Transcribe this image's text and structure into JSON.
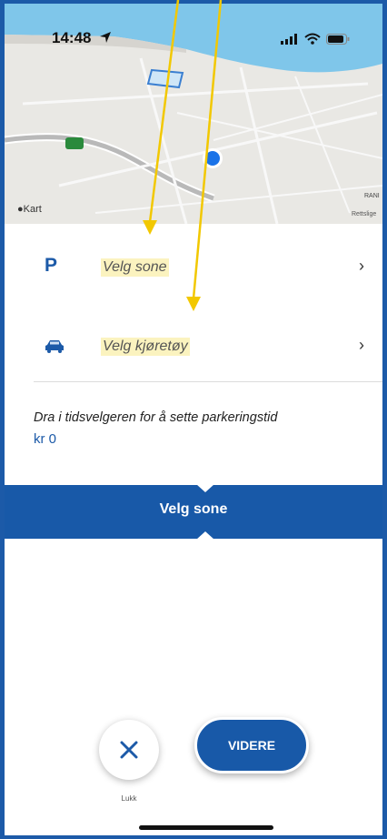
{
  "status_bar": {
    "time": "14:48"
  },
  "map": {
    "attribution": "Kart",
    "legal": "Rettslige",
    "place_label": "RANI"
  },
  "rows": [
    {
      "icon": "parking-p-icon",
      "glyph": "P",
      "label": "Velg sone"
    },
    {
      "icon": "car-icon",
      "label": "Velg kjøretøy"
    }
  ],
  "hint": "Dra i tidsvelgeren for å sette parkeringstid",
  "price": "kr 0",
  "band": {
    "title": "Velg sone"
  },
  "buttons": {
    "close_label": "Lukk",
    "next_label": "VIDERE"
  },
  "colors": {
    "accent": "#1859a8",
    "highlight": "#fbf3bf",
    "annotation_arrow": "#f2c800"
  }
}
